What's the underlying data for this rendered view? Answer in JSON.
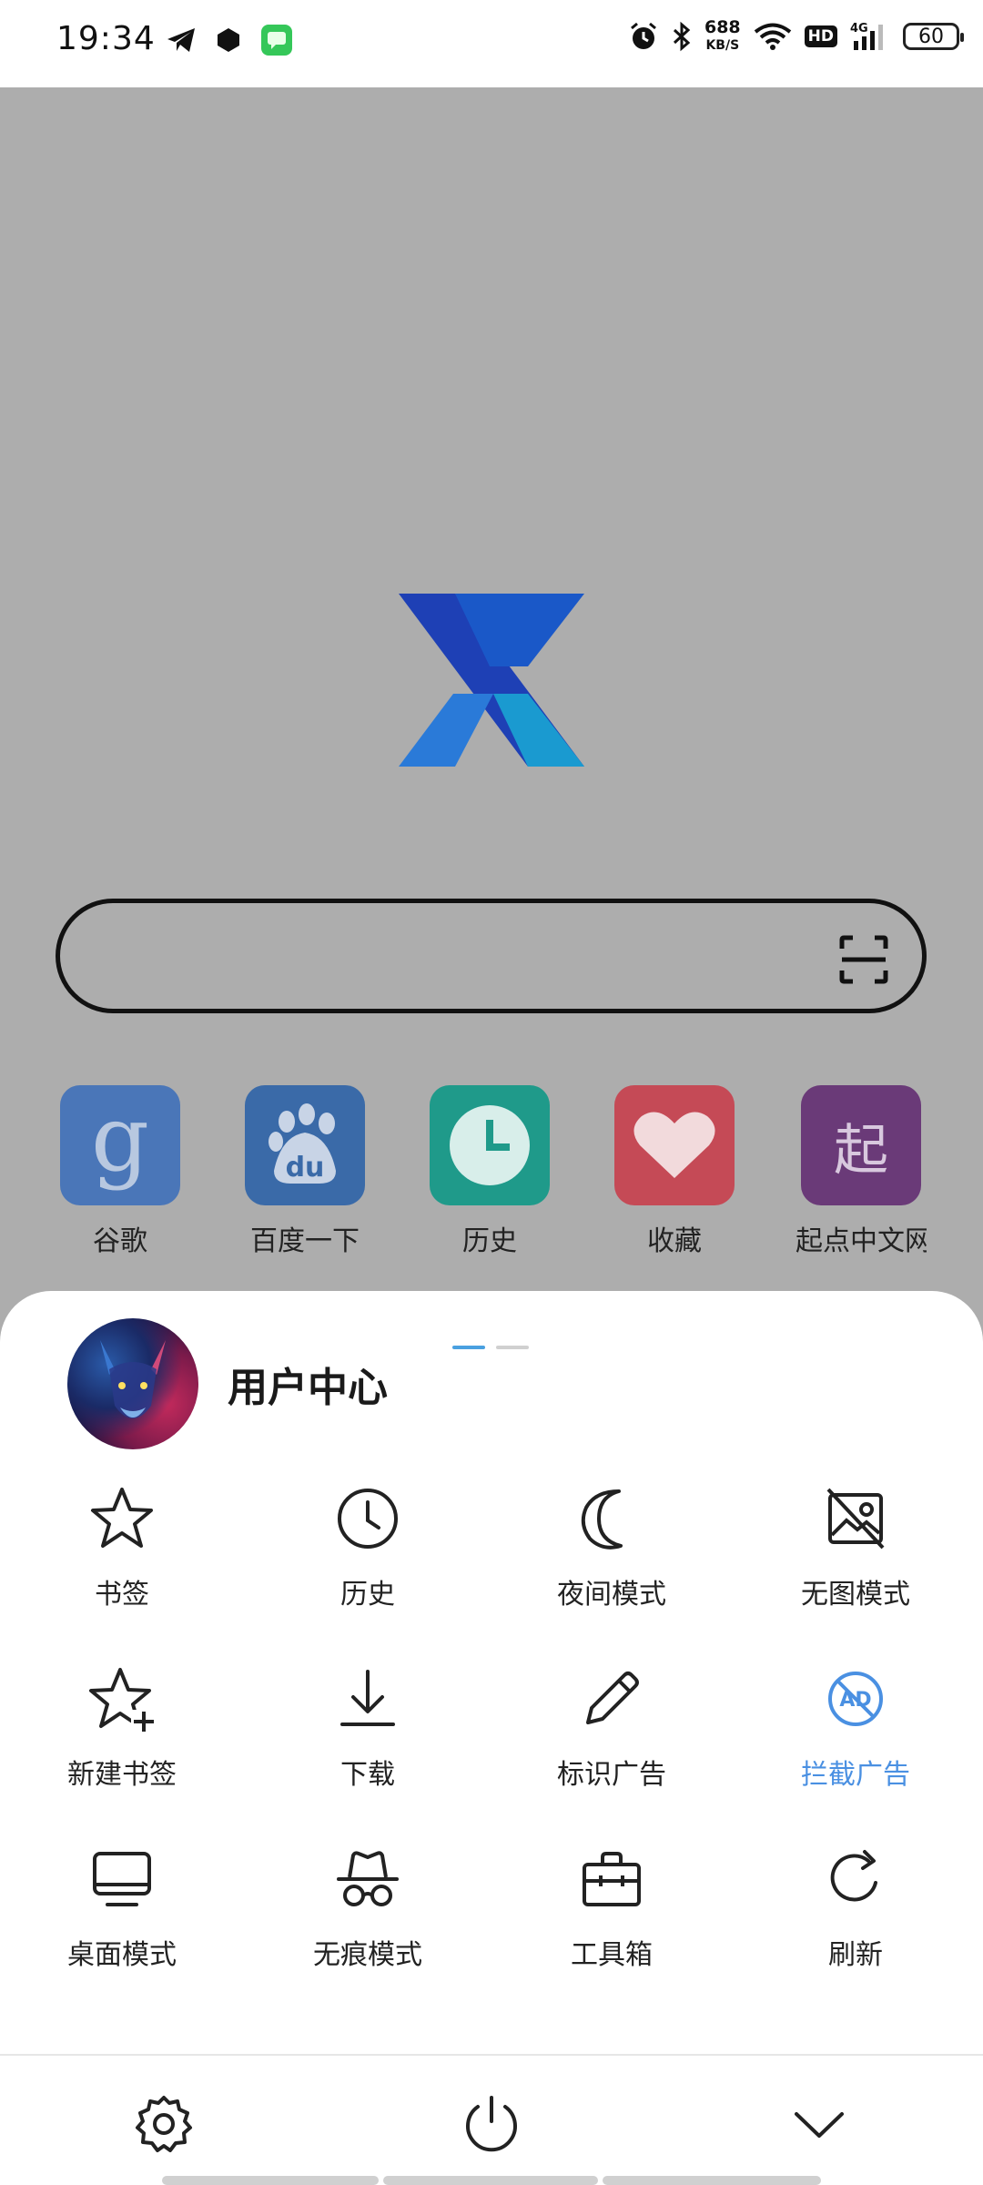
{
  "status_bar": {
    "time": "19:34",
    "net_speed_value": "688",
    "net_speed_unit": "KB/S",
    "hd_label": "HD",
    "network_type": "4G",
    "battery": "60"
  },
  "search": {
    "placeholder": ""
  },
  "shortcuts": [
    {
      "label": "谷歌",
      "glyph": "g",
      "color": "#4a76b8"
    },
    {
      "label": "百度一下",
      "glyph": "du",
      "color": "#3a6aa8"
    },
    {
      "label": "历史",
      "glyph": "clock",
      "color": "#1f9a8a"
    },
    {
      "label": "收藏",
      "glyph": "heart",
      "color": "#c54a56"
    },
    {
      "label": "起点中文网",
      "glyph": "起",
      "color": "#6a3a78"
    }
  ],
  "user_center": {
    "title": "用户中心"
  },
  "menu": [
    {
      "label": "书签",
      "icon": "star-icon"
    },
    {
      "label": "历史",
      "icon": "clock-icon"
    },
    {
      "label": "夜间模式",
      "icon": "moon-icon"
    },
    {
      "label": "无图模式",
      "icon": "no-image-icon"
    },
    {
      "label": "新建书签",
      "icon": "star-plus-icon"
    },
    {
      "label": "下载",
      "icon": "download-icon"
    },
    {
      "label": "标识广告",
      "icon": "pencil-icon"
    },
    {
      "label": "拦截广告",
      "icon": "ad-block-icon",
      "active": true
    },
    {
      "label": "桌面模式",
      "icon": "desktop-icon"
    },
    {
      "label": "无痕模式",
      "icon": "incognito-icon"
    },
    {
      "label": "工具箱",
      "icon": "toolbox-icon"
    },
    {
      "label": "刷新",
      "icon": "refresh-icon"
    }
  ],
  "pager": {
    "pages": 2,
    "current": 1
  },
  "colors": {
    "accent": "#4a90e2",
    "icon": "#222222",
    "dim_background": "#adadad"
  }
}
